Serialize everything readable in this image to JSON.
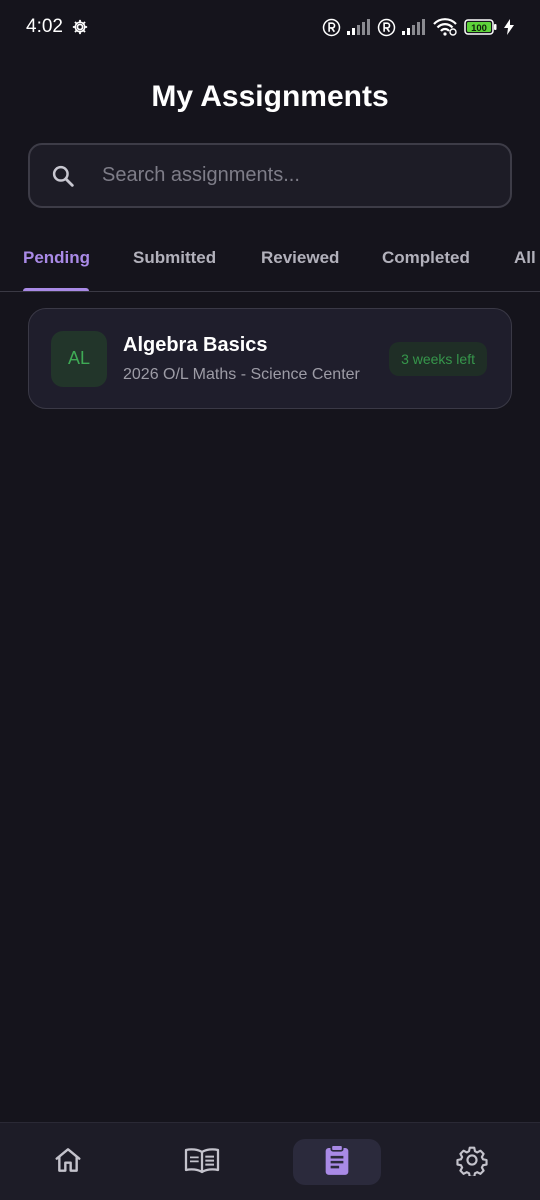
{
  "status_bar": {
    "time": "4:02",
    "battery": "100"
  },
  "header": {
    "title": "My Assignments"
  },
  "search": {
    "placeholder": "Search assignments..."
  },
  "tabs": [
    {
      "label": "Pending",
      "active": true
    },
    {
      "label": "Submitted",
      "active": false
    },
    {
      "label": "Reviewed",
      "active": false
    },
    {
      "label": "Completed",
      "active": false
    },
    {
      "label": "All",
      "active": false
    }
  ],
  "assignments": [
    {
      "initials": "AL",
      "title": "Algebra Basics",
      "subtitle": "2026 O/L Maths - Science Center",
      "due": "3 weeks left"
    }
  ],
  "bottom_nav": [
    {
      "icon": "home-icon",
      "active": false
    },
    {
      "icon": "book-icon",
      "active": false
    },
    {
      "icon": "clipboard-icon",
      "active": true
    },
    {
      "icon": "gear-icon",
      "active": false
    }
  ],
  "colors": {
    "background": "#15141c",
    "accent": "#a98ae6",
    "success": "#3faa55",
    "battery": "#5ed43a"
  }
}
